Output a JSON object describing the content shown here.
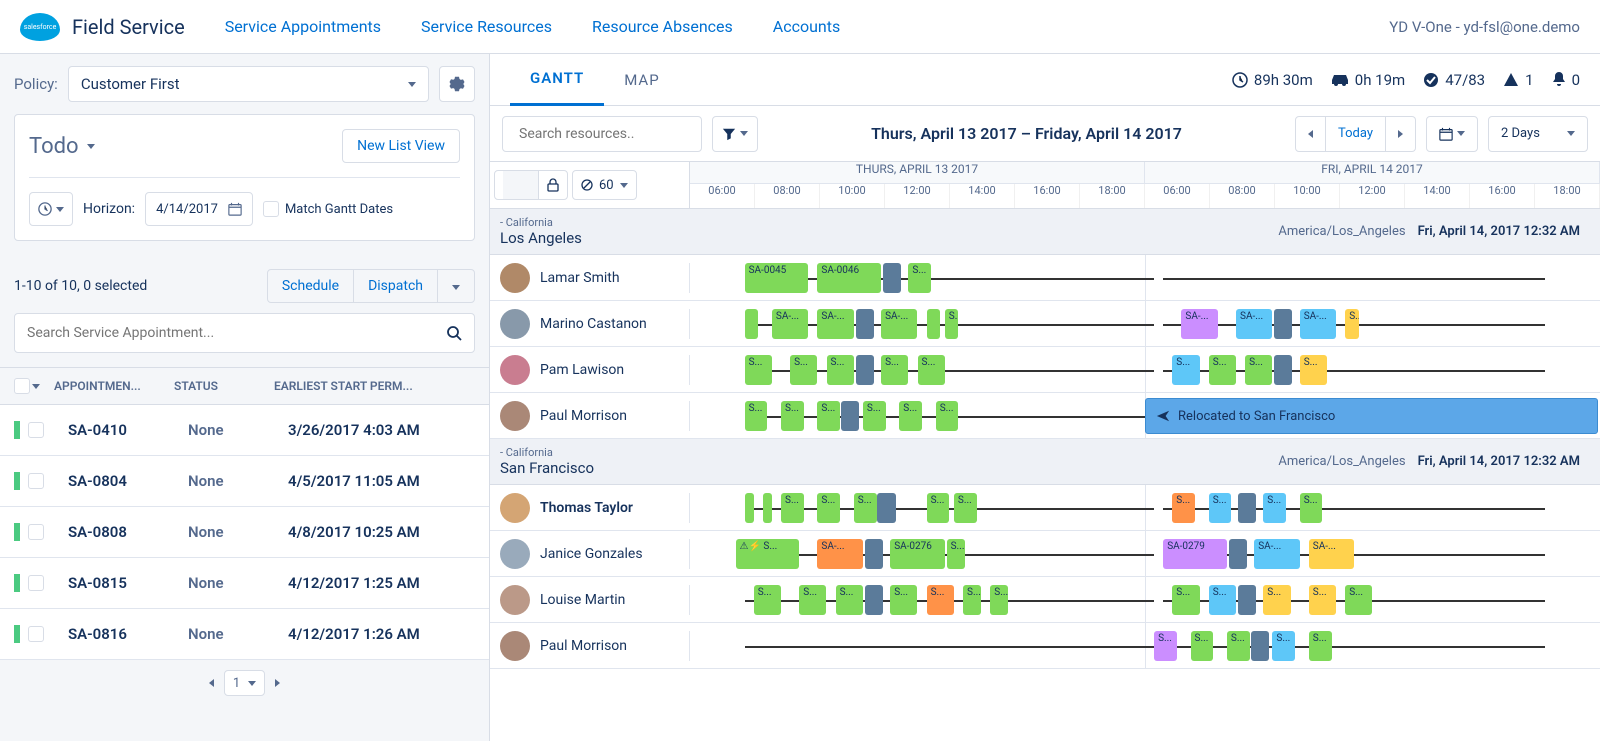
{
  "header": {
    "app_title": "Field Service",
    "nav": [
      "Service Appointments",
      "Service Resources",
      "Resource Absences",
      "Accounts"
    ],
    "user": "YD V-One - yd-fsl@one.demo"
  },
  "left": {
    "policy_label": "Policy:",
    "policy_value": "Customer First",
    "list_name": "Todo",
    "new_list_btn": "New List View",
    "horizon_label": "Horizon:",
    "horizon_date": "4/14/2017",
    "match_label": "Match Gantt Dates",
    "count_text": "1-10 of 10, 0 selected",
    "schedule_btn": "Schedule",
    "dispatch_btn": "Dispatch",
    "search_placeholder": "Search Service Appointment...",
    "cols": {
      "app": "APPOINTMEN...",
      "status": "STATUS",
      "date": "EARLIEST START PERM..."
    },
    "rows": [
      {
        "id": "SA-0410",
        "status": "None",
        "date": "3/26/2017 4:03 AM"
      },
      {
        "id": "SA-0804",
        "status": "None",
        "date": "4/5/2017 11:05 AM"
      },
      {
        "id": "SA-0808",
        "status": "None",
        "date": "4/8/2017 10:25 AM"
      },
      {
        "id": "SA-0815",
        "status": "None",
        "date": "4/12/2017 1:25 AM"
      },
      {
        "id": "SA-0816",
        "status": "None",
        "date": "4/12/2017 1:26 AM"
      }
    ],
    "page": "1"
  },
  "right": {
    "tabs": {
      "gantt": "GANTT",
      "map": "MAP"
    },
    "stats": {
      "hours": "89h 30m",
      "drive": "0h 19m",
      "done": "47/83",
      "warn": "1",
      "bell": "0"
    },
    "search_placeholder": "Search resources..",
    "date_range": "Thurs, April 13 2017 – Friday, April 14 2017",
    "today": "Today",
    "span": "2 Days",
    "util": "60",
    "day1": "THURS, APRIL 13 2017",
    "day2": "FRI, APRIL 14 2017",
    "hours": [
      "06:00",
      "08:00",
      "10:00",
      "12:00",
      "14:00",
      "16:00",
      "18:00"
    ],
    "territories": [
      {
        "state": "California",
        "name": "Los Angeles",
        "tz": "America/Los_Angeles",
        "ts": "Fri, April 14, 2017 12:32 AM",
        "resources": [
          {
            "name": "Lamar Smith",
            "avatar": "#b08968",
            "appts": [
              {
                "l": 6,
                "w": 7,
                "c": "green",
                "t": "SA-0045"
              },
              {
                "l": 14,
                "w": 7,
                "c": "green",
                "t": "SA-0046"
              },
              {
                "l": 21.2,
                "w": 2,
                "c": "darkblue",
                "t": ""
              },
              {
                "l": 24,
                "w": 2.5,
                "c": "green",
                "t": "S..."
              }
            ]
          },
          {
            "name": "Marino Castanon",
            "avatar": "#8899aa",
            "appts": [
              {
                "l": 6,
                "w": 1.5,
                "c": "green",
                "t": ""
              },
              {
                "l": 9,
                "w": 4,
                "c": "green",
                "t": "SA-..."
              },
              {
                "l": 14,
                "w": 4,
                "c": "green",
                "t": "SA-..."
              },
              {
                "l": 18.2,
                "w": 2,
                "c": "darkblue",
                "t": ""
              },
              {
                "l": 21,
                "w": 4,
                "c": "green",
                "t": "SA-..."
              },
              {
                "l": 26,
                "w": 1.5,
                "c": "green",
                "t": ""
              },
              {
                "l": 28,
                "w": 1.5,
                "c": "green",
                "t": "S..."
              },
              {
                "l": 54,
                "w": 4,
                "c": "purple",
                "t": "SA-..."
              },
              {
                "l": 60,
                "w": 4,
                "c": "blue",
                "t": "SA-..."
              },
              {
                "l": 64.2,
                "w": 2,
                "c": "darkblue",
                "t": ""
              },
              {
                "l": 67,
                "w": 4,
                "c": "blue",
                "t": "SA-..."
              },
              {
                "l": 72,
                "w": 1.5,
                "c": "yellow",
                "t": "S..."
              }
            ]
          },
          {
            "name": "Pam Lawison",
            "avatar": "#c97d90",
            "appts": [
              {
                "l": 6,
                "w": 3,
                "c": "green",
                "t": "S..."
              },
              {
                "l": 11,
                "w": 3,
                "c": "green",
                "t": "S..."
              },
              {
                "l": 15,
                "w": 3,
                "c": "green",
                "t": "S..."
              },
              {
                "l": 18.2,
                "w": 2,
                "c": "darkblue",
                "t": ""
              },
              {
                "l": 21,
                "w": 3,
                "c": "green",
                "t": "S..."
              },
              {
                "l": 25,
                "w": 3,
                "c": "green",
                "t": "S..."
              },
              {
                "l": 53,
                "w": 3,
                "c": "blue",
                "t": "S..."
              },
              {
                "l": 57,
                "w": 3,
                "c": "green",
                "t": "S..."
              },
              {
                "l": 61,
                "w": 3,
                "c": "green",
                "t": "S..."
              },
              {
                "l": 64.2,
                "w": 2,
                "c": "darkblue",
                "t": ""
              },
              {
                "l": 67,
                "w": 3,
                "c": "yellow",
                "t": "S..."
              }
            ]
          },
          {
            "name": "Paul Morrison",
            "avatar": "#aa8877",
            "relocated": "Relocated to San Francisco",
            "appts": [
              {
                "l": 6,
                "w": 2.5,
                "c": "green",
                "t": "S..."
              },
              {
                "l": 10,
                "w": 2.5,
                "c": "green",
                "t": "S..."
              },
              {
                "l": 14,
                "w": 2.5,
                "c": "green",
                "t": "S..."
              },
              {
                "l": 16.6,
                "w": 2,
                "c": "darkblue",
                "t": ""
              },
              {
                "l": 19,
                "w": 2.5,
                "c": "green",
                "t": "S..."
              },
              {
                "l": 23,
                "w": 2.5,
                "c": "green",
                "t": "S..."
              },
              {
                "l": 27,
                "w": 2.5,
                "c": "green",
                "t": "S..."
              }
            ]
          }
        ]
      },
      {
        "state": "California",
        "name": "San Francisco",
        "tz": "America/Los_Angeles",
        "ts": "Fri, April 14, 2017 12:32 AM",
        "resources": [
          {
            "name": "Thomas Taylor",
            "avatar": "#d4a574",
            "bold": true,
            "appts": [
              {
                "l": 6,
                "w": 1,
                "c": "green",
                "t": ""
              },
              {
                "l": 8,
                "w": 1,
                "c": "green",
                "t": ""
              },
              {
                "l": 10,
                "w": 2.5,
                "c": "green",
                "t": "S..."
              },
              {
                "l": 14,
                "w": 2.5,
                "c": "green",
                "t": "S..."
              },
              {
                "l": 18,
                "w": 2.5,
                "c": "green",
                "t": "S..."
              },
              {
                "l": 20.6,
                "w": 2,
                "c": "darkblue",
                "t": ""
              },
              {
                "l": 26,
                "w": 2.5,
                "c": "green",
                "t": "S..."
              },
              {
                "l": 29,
                "w": 2.5,
                "c": "green",
                "t": "S..."
              },
              {
                "l": 53,
                "w": 2.5,
                "c": "orange",
                "t": "S..."
              },
              {
                "l": 57,
                "w": 2.5,
                "c": "blue",
                "t": "S..."
              },
              {
                "l": 60.2,
                "w": 2,
                "c": "darkblue",
                "t": ""
              },
              {
                "l": 63,
                "w": 2.5,
                "c": "blue",
                "t": "S..."
              },
              {
                "l": 67,
                "w": 2.5,
                "c": "green",
                "t": "S..."
              }
            ]
          },
          {
            "name": "Janice Gonzales",
            "avatar": "#99aabb",
            "appts": [
              {
                "l": 5,
                "w": 7,
                "c": "green",
                "t": "⚠⚡ S..."
              },
              {
                "l": 14,
                "w": 5,
                "c": "orange",
                "t": "SA-..."
              },
              {
                "l": 19.2,
                "w": 2,
                "c": "darkblue",
                "t": ""
              },
              {
                "l": 22,
                "w": 6,
                "c": "green",
                "t": "SA-0276"
              },
              {
                "l": 28.2,
                "w": 2,
                "c": "green",
                "t": "S..."
              },
              {
                "l": 52,
                "w": 7,
                "c": "purple",
                "t": "SA-0279"
              },
              {
                "l": 59.2,
                "w": 2,
                "c": "darkblue",
                "t": ""
              },
              {
                "l": 62,
                "w": 5,
                "c": "blue",
                "t": "SA-..."
              },
              {
                "l": 68,
                "w": 5,
                "c": "yellow",
                "t": "SA-..."
              }
            ]
          },
          {
            "name": "Louise Martin",
            "avatar": "#bb9988",
            "appts": [
              {
                "l": 7,
                "w": 3,
                "c": "green",
                "t": "S..."
              },
              {
                "l": 12,
                "w": 3,
                "c": "green",
                "t": "S..."
              },
              {
                "l": 16,
                "w": 3,
                "c": "green",
                "t": "S..."
              },
              {
                "l": 19.2,
                "w": 2,
                "c": "darkblue",
                "t": ""
              },
              {
                "l": 22,
                "w": 3,
                "c": "green",
                "t": "S..."
              },
              {
                "l": 26,
                "w": 3,
                "c": "orange",
                "t": "S..."
              },
              {
                "l": 30,
                "w": 2,
                "c": "green",
                "t": "S..."
              },
              {
                "l": 33,
                "w": 2,
                "c": "green",
                "t": "S..."
              },
              {
                "l": 53,
                "w": 3,
                "c": "green",
                "t": "S..."
              },
              {
                "l": 57,
                "w": 3,
                "c": "blue",
                "t": "S..."
              },
              {
                "l": 60.2,
                "w": 2,
                "c": "darkblue",
                "t": ""
              },
              {
                "l": 63,
                "w": 3,
                "c": "yellow",
                "t": "S..."
              },
              {
                "l": 68,
                "w": 3,
                "c": "yellow",
                "t": "S..."
              },
              {
                "l": 72,
                "w": 3,
                "c": "green",
                "t": "S..."
              }
            ]
          },
          {
            "name": "Paul Morrison",
            "avatar": "#aa8877",
            "appts": [
              {
                "l": 51,
                "w": 2.5,
                "c": "purple",
                "t": "S..."
              },
              {
                "l": 55,
                "w": 2.5,
                "c": "green",
                "t": "S..."
              },
              {
                "l": 59,
                "w": 2.5,
                "c": "green",
                "t": "S..."
              },
              {
                "l": 61.6,
                "w": 2,
                "c": "darkblue",
                "t": ""
              },
              {
                "l": 64,
                "w": 2.5,
                "c": "blue",
                "t": "S..."
              },
              {
                "l": 68,
                "w": 2.5,
                "c": "green",
                "t": "S..."
              }
            ]
          }
        ]
      }
    ]
  }
}
